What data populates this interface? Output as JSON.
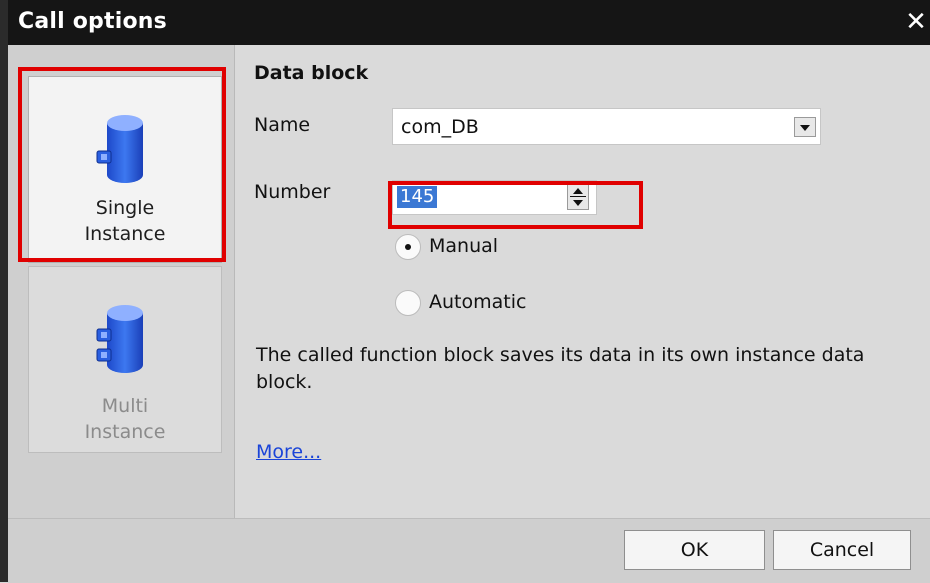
{
  "window": {
    "title": "Call options",
    "close_icon": "close-icon"
  },
  "sidebar": {
    "items": [
      {
        "label_line1": "Single",
        "label_line2": "Instance",
        "icon": "database-icon",
        "selected": true
      },
      {
        "label_line1": "Multi",
        "label_line2": "Instance",
        "icon": "database-multi-icon",
        "selected": false
      }
    ]
  },
  "data_block": {
    "heading": "Data block",
    "name_label": "Name",
    "name_value": "com_DB",
    "number_label": "Number",
    "number_value": "145",
    "radio_manual_label": "Manual",
    "radio_automatic_label": "Automatic",
    "selected_radio": "Manual"
  },
  "description": "The called function block saves its data in its own instance data block.",
  "more_link": "More...",
  "buttons": {
    "ok": "OK",
    "cancel": "Cancel"
  },
  "colors": {
    "title_bar": "#151515",
    "highlight": "#e00000",
    "selection": "#3b78d4",
    "link": "#1a44d8",
    "db_icon": "#2a5fe0"
  }
}
